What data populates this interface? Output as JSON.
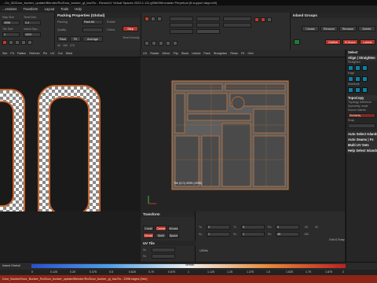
{
  "window": {
    "title": "...Ox_3D/Door_bunker_update/Blender/Ro/Door_bunker_gl_low.Ro - RizomUV  Virtual Spaces 2020.1.111.g99b09bf.master Perpetual  (8 support days left)"
  },
  "menu": [
    "...erations",
    "Transform",
    "Layout",
    "Tools",
    "Help"
  ],
  "toolbar_left": {
    "labels": [
      "Map Size",
      "Texel Den.",
      "Tile Size",
      "Island Spa..."
    ],
    "map_size": "4096",
    "texel_density": "0.4",
    "tile_size": "1",
    "unit": "1024"
  },
  "packing": {
    "title": "Packing Properties (Global)",
    "mode_label": "Packing",
    "mode_value": "Pack All",
    "rotate_label": "Rotate",
    "rotate_value": "Step",
    "texel_label": "Texel Density",
    "quality_label": "Quality",
    "quality_value": "Average",
    "buttons": [
      "Pack",
      "Fit"
    ],
    "orient_label": "Orient.",
    "angles": [
      "90",
      "180",
      "270"
    ]
  },
  "grouping": {
    "title": "Island Groups",
    "create": "Create",
    "remove": "Remove",
    "rename": "Rename",
    "delete": "Delete",
    "outline": "Outline",
    "b_score": "B.Score",
    "label_btn": "Labels"
  },
  "viewport_left": {
    "tools": [
      "Slct",
      "Fit",
      "Flatten",
      "Refresh",
      "Pin",
      "UV",
      "Cut",
      "Weld"
    ]
  },
  "viewport_uv": {
    "tools": [
      "UV",
      "Rotate",
      "Mirror",
      "Flip",
      "Stack",
      "Unfold",
      "Pack",
      "Straighten",
      "Relax",
      "Fit",
      "Grid"
    ],
    "tile_label": "Tile (0,0) 4096 (4096)"
  },
  "right_panel": {
    "select_title": "Select",
    "align_title": "Align | Straighten",
    "straighten_label": "Straighten",
    "edge_label": "Edge",
    "distribute_label": "Distribute",
    "topocopy_title": "TopoCopy",
    "settings": [
      "Topology reference",
      "Symmetry mode",
      "Source islands",
      "Similarity"
    ],
    "snap_label": "Snap",
    "auto_select": "Auto Select Islands",
    "auto_seams": "Auto Seams | Fx",
    "multi_uv": "Multi UV Sets",
    "help_select": "Help Select Islands"
  },
  "transform": {
    "title": "Transform",
    "modes": [
      "Local",
      "Center",
      "Mouse"
    ],
    "world": "World",
    "multi": "Multi",
    "space": "Space",
    "fields": [
      {
        "label": "Tu",
        "value": "0"
      },
      {
        "label": "Tv",
        "value": "0"
      },
      {
        "label": "Ro",
        "value": "0"
      },
      {
        "label": "Su",
        "value": "1"
      },
      {
        "label": "Sv",
        "value": "1"
      },
      {
        "label": "Rc",
        "value": "45"
      }
    ],
    "step_vals": [
      "-90",
      "90",
      "180"
    ]
  },
  "uv_tile": {
    "title": "UV Tile",
    "su": "Su",
    "sv": "Sv",
    "side_label": "Grid & Snap",
    "side_label2": "UDIMs"
  },
  "ruler": {
    "label": "Island Stretch",
    "ticks": [
      "0",
      "0.125",
      "0.25",
      "0.375",
      "0.5",
      "0.625",
      "0.75",
      "0.875",
      "1",
      "1.125",
      "1.25",
      "1.375",
      "1.5",
      "1.625",
      "1.75",
      "1.875",
      "2"
    ],
    "stretch_label": "Stretch"
  },
  "status": {
    "text": "Door_Bunker/Door_Bunker_Ro/Door_bunker_update/Blender/Ro/Door_bunker_gl_low.Ro - 2098 edges (free)"
  },
  "colors": {
    "accent": "#c03a2b",
    "orange": "#c05a1f",
    "teal": "#0f7ea0",
    "uv_wire": "#d27a3a"
  }
}
